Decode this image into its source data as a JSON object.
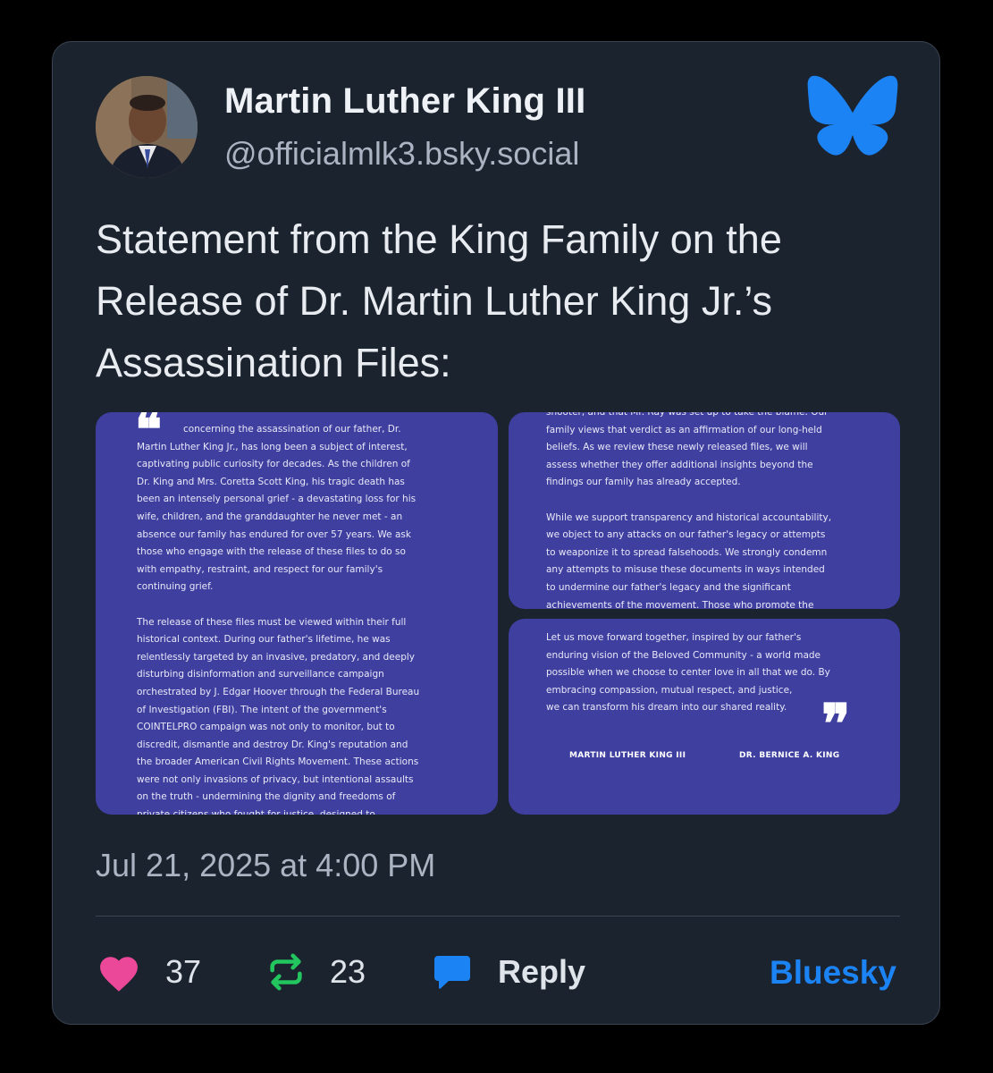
{
  "post": {
    "author_name": "Martin Luther King III",
    "author_handle": "@officialmlk3.bsky.social",
    "text_lines": [
      "Statement from the King Family on the",
      "Release of Dr. Martin Luther King Jr.’s",
      "Assassination Files:"
    ],
    "timestamp": "Jul 21, 2025 at 4:00 PM",
    "likes": "37",
    "reposts": "23",
    "reply_label": "Reply",
    "platform_link": "Bluesky"
  },
  "images": {
    "image1_lines": [
      "concerning the assassination of our father, Dr.",
      "Martin Luther King Jr., has long been a subject of interest,",
      "captivating public curiosity for decades. As the children of",
      "Dr. King and Mrs. Coretta Scott King, his tragic death has",
      "been an intensely personal grief - a devastating loss for his",
      "wife, children, and the granddaughter he never met - an",
      "absence our family has endured for over 57 years. We ask",
      "those who engage with the release of these files to do so",
      "with empathy, restraint, and respect for our family's",
      "continuing grief.",
      "",
      "The release of these files must be viewed within their full",
      "historical context. During our father's lifetime, he was",
      "relentlessly targeted by an invasive, predatory, and deeply",
      "disturbing disinformation and surveillance campaign",
      "orchestrated by J. Edgar Hoover through the Federal Bureau",
      "of Investigation (FBI).  The intent of the government's",
      "COINTELPRO campaign was not only to monitor, but to",
      "discredit, dismantle and destroy Dr. King's reputation and",
      "the broader American Civil Rights Movement. These actions",
      "were not only invasions of privacy, but intentional assaults",
      "on the truth - undermining the dignity and freedoms of",
      "private citizens who fought for justice, designed to"
    ],
    "image2_lines": [
      "shooter, and that Mr. Ray was set up to take the blame. Our",
      "family views that verdict as an affirmation of our long-held",
      "beliefs. As we review these newly released files, we will",
      "assess whether they offer additional insights beyond the",
      "findings our family has already accepted.",
      "",
      "While we support transparency and historical accountability,",
      "we object to any attacks on our father's legacy or attempts",
      "to weaponize it to spread falsehoods. We strongly condemn",
      "any attempts to misuse these documents in ways intended",
      "to undermine our father's legacy and the significant",
      "achievements of the movement. Those who promote the"
    ],
    "image3_lines": [
      "Let us move forward together, inspired by our father's",
      "enduring vision of the Beloved Community - a world made",
      "possible when we choose to center love in all that we do. By",
      "embracing compassion, mutual respect, and justice,",
      "we can transform his dream into our shared reality."
    ],
    "signature_left": "MARTIN LUTHER KING III",
    "signature_right": "DR. BERNICE A. KING",
    "open_quote": "❝",
    "close_quote": "❞"
  },
  "colors": {
    "card_background": "#1b232e",
    "image_background": "#3f3fa0",
    "like_pink": "#ec4899",
    "repost_green": "#22c55e",
    "reply_blue": "#1c83f4",
    "bluesky_blue": "#1c83f4"
  },
  "icons": {
    "brand": "bluesky-butterfly-icon",
    "like": "heart-icon",
    "repost": "repost-icon",
    "reply": "speech-bubble-icon"
  }
}
